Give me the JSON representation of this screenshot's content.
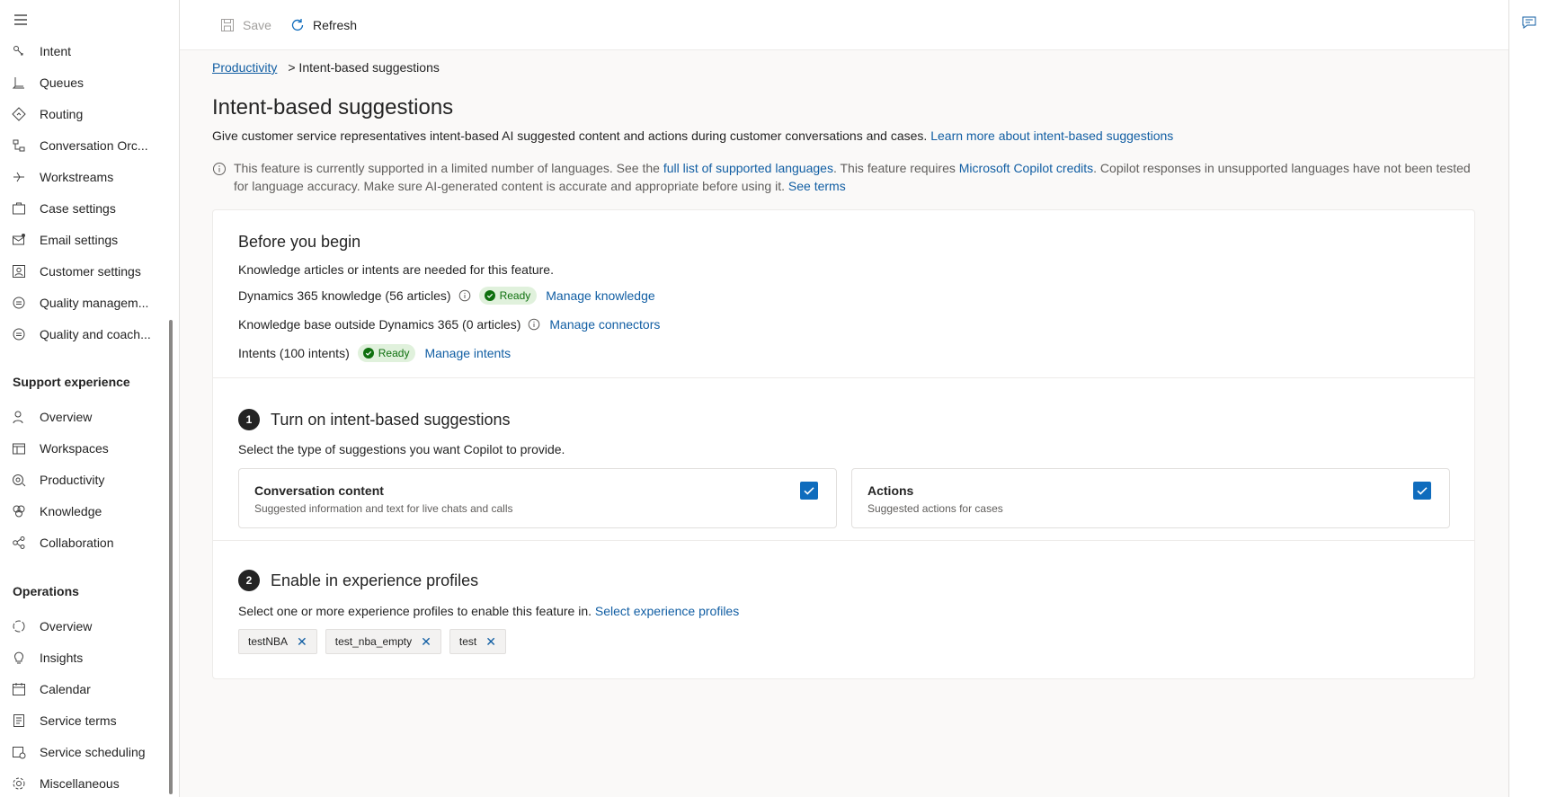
{
  "sidebar": {
    "items_top": [
      {
        "label": "Intent",
        "icon": "intent-icon"
      },
      {
        "label": "Queues",
        "icon": "queues-icon"
      },
      {
        "label": "Routing",
        "icon": "routing-icon"
      },
      {
        "label": "Conversation Orc...",
        "icon": "conversation-icon"
      },
      {
        "label": "Workstreams",
        "icon": "workstreams-icon"
      },
      {
        "label": "Case settings",
        "icon": "case-icon"
      },
      {
        "label": "Email settings",
        "icon": "email-icon"
      },
      {
        "label": "Customer settings",
        "icon": "customer-icon"
      },
      {
        "label": "Quality managem...",
        "icon": "quality-icon"
      },
      {
        "label": "Quality and coach...",
        "icon": "coaching-icon"
      }
    ],
    "section_support": "Support experience",
    "items_support": [
      {
        "label": "Overview",
        "icon": "person-icon"
      },
      {
        "label": "Workspaces",
        "icon": "workspaces-icon"
      },
      {
        "label": "Productivity",
        "icon": "productivity-icon"
      },
      {
        "label": "Knowledge",
        "icon": "knowledge-icon"
      },
      {
        "label": "Collaboration",
        "icon": "collaboration-icon"
      }
    ],
    "section_operations": "Operations",
    "items_operations": [
      {
        "label": "Overview",
        "icon": "overview-icon"
      },
      {
        "label": "Insights",
        "icon": "lightbulb-icon"
      },
      {
        "label": "Calendar",
        "icon": "calendar-icon"
      },
      {
        "label": "Service terms",
        "icon": "terms-icon"
      },
      {
        "label": "Service scheduling",
        "icon": "scheduling-icon"
      },
      {
        "label": "Miscellaneous",
        "icon": "gear-icon"
      }
    ]
  },
  "toolbar": {
    "save_label": "Save",
    "refresh_label": "Refresh"
  },
  "breadcrumb": {
    "parent": "Productivity",
    "current": "> Intent-based suggestions"
  },
  "page": {
    "title": "Intent-based suggestions",
    "description": "Give customer service representatives intent-based AI suggested content and actions during customer conversations and cases.",
    "description_link": "Learn more about intent-based suggestions",
    "note_part1": "This feature is currently supported in a limited number of languages. See the",
    "note_link1": "full list of supported languages",
    "note_part2": ". This feature requires",
    "note_link2": "Microsoft Copilot credits",
    "note_part3": ". Copilot responses in unsupported languages have not been tested for language accuracy. Make sure AI-generated content is accurate and appropriate before using it.",
    "note_link3": "See terms"
  },
  "before": {
    "title": "Before you begin",
    "subtitle": "Knowledge articles or intents are needed for this feature.",
    "d365_label": "Dynamics 365 knowledge (56 articles)",
    "d365_status": "Ready",
    "d365_link": "Manage knowledge",
    "kb_label": "Knowledge base outside Dynamics 365 (0 articles)",
    "kb_link": "Manage connectors",
    "intents_label": "Intents (100 intents)",
    "intents_status": "Ready",
    "intents_link": "Manage intents"
  },
  "step1": {
    "num": "1",
    "title": "Turn on intent-based suggestions",
    "subtitle": "Select the type of suggestions you want Copilot to provide.",
    "opt1_title": "Conversation content",
    "opt1_desc": "Suggested information and text for live chats and calls",
    "opt1_checked": true,
    "opt2_title": "Actions",
    "opt2_desc": "Suggested actions for cases",
    "opt2_checked": true
  },
  "step2": {
    "num": "2",
    "title": "Enable in experience profiles",
    "subtitle": "Select one or more experience profiles to enable this feature in.",
    "link": "Select experience profiles",
    "tags": [
      "testNBA",
      "test_nba_empty",
      "test"
    ]
  },
  "colors": {
    "accent": "#0f6cbd",
    "link": "#115ea3",
    "ready_bg": "#e0f1dc",
    "ready_fg": "#0e700e"
  }
}
